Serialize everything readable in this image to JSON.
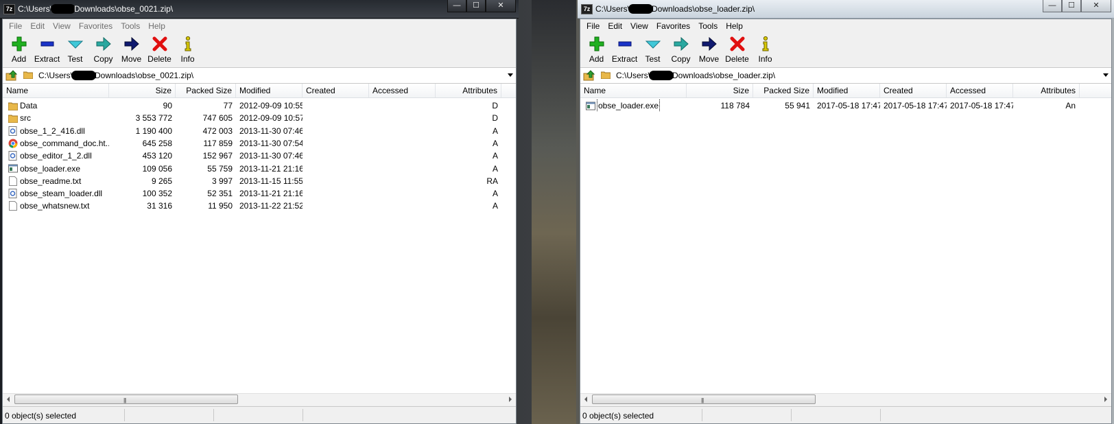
{
  "left_window": {
    "title_prefix": "C:\\Users\\",
    "title_suffix": "Downloads\\obse_0021.zip\\",
    "menu": [
      "File",
      "Edit",
      "View",
      "Favorites",
      "Tools",
      "Help"
    ],
    "toolbar": [
      "Add",
      "Extract",
      "Test",
      "Copy",
      "Move",
      "Delete",
      "Info"
    ],
    "address_prefix": "C:\\Users\\",
    "address_suffix": "Downloads\\obse_0021.zip\\",
    "columns": [
      "Name",
      "Size",
      "Packed Size",
      "Modified",
      "Created",
      "Accessed",
      "Attributes"
    ],
    "rows": [
      {
        "icon": "folder-icon",
        "name": "Data",
        "size": "90",
        "packed": "77",
        "modified": "2012-09-09 10:55",
        "created": "",
        "accessed": "",
        "attributes": "D"
      },
      {
        "icon": "folder-icon",
        "name": "src",
        "size": "3 553 772",
        "packed": "747 605",
        "modified": "2012-09-09 10:57",
        "created": "",
        "accessed": "",
        "attributes": "D"
      },
      {
        "icon": "dll-icon",
        "name": "obse_1_2_416.dll",
        "size": "1 190 400",
        "packed": "472 003",
        "modified": "2013-11-30 07:46",
        "created": "",
        "accessed": "",
        "attributes": "A"
      },
      {
        "icon": "chrome-icon",
        "name": "obse_command_doc.ht...",
        "size": "645 258",
        "packed": "117 859",
        "modified": "2013-11-30 07:54",
        "created": "",
        "accessed": "",
        "attributes": "A"
      },
      {
        "icon": "dll-icon",
        "name": "obse_editor_1_2.dll",
        "size": "453 120",
        "packed": "152 967",
        "modified": "2013-11-30 07:46",
        "created": "",
        "accessed": "",
        "attributes": "A"
      },
      {
        "icon": "exe-icon",
        "name": "obse_loader.exe",
        "size": "109 056",
        "packed": "55 759",
        "modified": "2013-11-21 21:16",
        "created": "",
        "accessed": "",
        "attributes": "A"
      },
      {
        "icon": "text-file-icon",
        "name": "obse_readme.txt",
        "size": "9 265",
        "packed": "3 997",
        "modified": "2013-11-15 11:55",
        "created": "",
        "accessed": "",
        "attributes": "RA"
      },
      {
        "icon": "dll-icon",
        "name": "obse_steam_loader.dll",
        "size": "100 352",
        "packed": "52 351",
        "modified": "2013-11-21 21:16",
        "created": "",
        "accessed": "",
        "attributes": "A"
      },
      {
        "icon": "text-file-icon",
        "name": "obse_whatsnew.txt",
        "size": "31 316",
        "packed": "11 950",
        "modified": "2013-11-22 21:52",
        "created": "",
        "accessed": "",
        "attributes": "A"
      }
    ],
    "status": "0 object(s) selected"
  },
  "right_window": {
    "title_prefix": "C:\\Users\\",
    "title_suffix": "Downloads\\obse_loader.zip\\",
    "menu": [
      "File",
      "Edit",
      "View",
      "Favorites",
      "Tools",
      "Help"
    ],
    "toolbar": [
      "Add",
      "Extract",
      "Test",
      "Copy",
      "Move",
      "Delete",
      "Info"
    ],
    "address_prefix": "C:\\Users\\",
    "address_suffix": "Downloads\\obse_loader.zip\\",
    "columns": [
      "Name",
      "Size",
      "Packed Size",
      "Modified",
      "Created",
      "Accessed",
      "Attributes"
    ],
    "rows": [
      {
        "icon": "exe-icon",
        "name": "obse_loader.exe",
        "size": "118 784",
        "packed": "55 941",
        "modified": "2017-05-18 17:47",
        "created": "2017-05-18 17:47",
        "accessed": "2017-05-18 17:47",
        "attributes": "An"
      }
    ],
    "status": "0 object(s) selected"
  },
  "window_controls": {
    "minimize": "—",
    "maximize": "☐",
    "close": "✕"
  },
  "app_icon_text": "7z",
  "colors": {
    "add": "#20b020",
    "extract": "#1a33c8",
    "test": "#40c8d8",
    "copy": "#2aa8a0",
    "move": "#101a70",
    "delete": "#e01010",
    "info": "#d8c800",
    "folder": "#e8b84a"
  }
}
